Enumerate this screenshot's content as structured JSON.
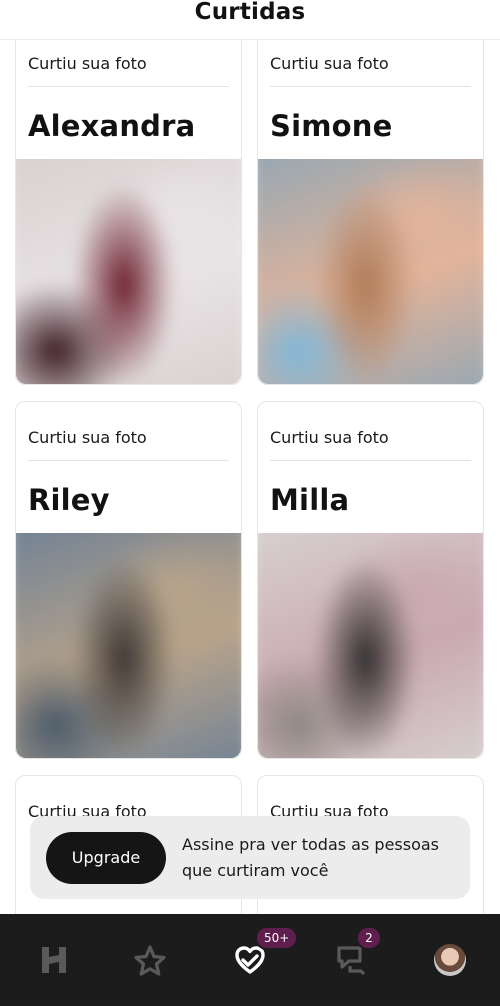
{
  "header": {
    "title": "Curtidas"
  },
  "cards": [
    {
      "label": "Curtiu sua foto",
      "name": "Alexandra",
      "photo_colors": [
        "#d6cfcf",
        "#6b1d2a",
        "#e9e4e6",
        "#3a1a22"
      ]
    },
    {
      "label": "Curtiu sua foto",
      "name": "Simone",
      "photo_colors": [
        "#8fa6b5",
        "#b07a56",
        "#e3b49a",
        "#7fb7d9"
      ]
    },
    {
      "label": "Curtiu sua foto",
      "name": "Riley",
      "photo_colors": [
        "#6b7f96",
        "#3b3532",
        "#b9a48a",
        "#4a5a6a"
      ]
    },
    {
      "label": "Curtiu sua foto",
      "name": "Milla",
      "photo_colors": [
        "#d9d4d2",
        "#2f2c2c",
        "#c9a9b0",
        "#8d8782"
      ]
    },
    {
      "label": "Curtiu sua foto",
      "name": ""
    },
    {
      "label": "Curtiu sua foto",
      "name": ""
    }
  ],
  "upgrade": {
    "button_label": "Upgrade",
    "text": "Assine pra ver todas as pessoas que curtiram você"
  },
  "tabbar": {
    "items": [
      {
        "icon": "hinge-logo-icon"
      },
      {
        "icon": "star-icon"
      },
      {
        "icon": "likes-heart-icon",
        "badge": "50+"
      },
      {
        "icon": "chat-bubbles-icon",
        "badge": "2"
      },
      {
        "icon": "profile-avatar-icon"
      }
    ],
    "badge_color": "#5f1e4e",
    "background": "#1c1c1c"
  }
}
